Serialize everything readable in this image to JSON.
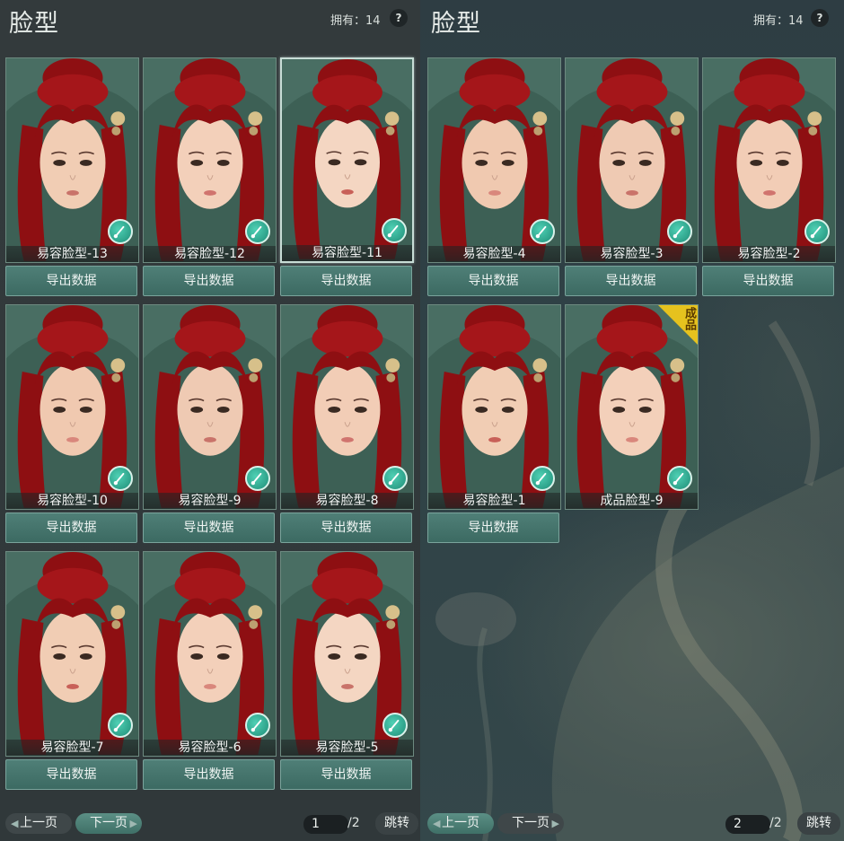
{
  "left_panel": {
    "title": "脸型",
    "owned_label": "拥有：14",
    "help_label": "?",
    "cards": [
      {
        "label": "易容脸型-13",
        "export": "导出数据",
        "selected": false,
        "tag": ""
      },
      {
        "label": "易容脸型-12",
        "export": "导出数据",
        "selected": false,
        "tag": ""
      },
      {
        "label": "易容脸型-11",
        "export": "导出数据",
        "selected": true,
        "tag": ""
      },
      {
        "label": "易容脸型-10",
        "export": "导出数据",
        "selected": false,
        "tag": ""
      },
      {
        "label": "易容脸型-9",
        "export": "导出数据",
        "selected": false,
        "tag": ""
      },
      {
        "label": "易容脸型-8",
        "export": "导出数据",
        "selected": false,
        "tag": ""
      },
      {
        "label": "易容脸型-7",
        "export": "导出数据",
        "selected": false,
        "tag": ""
      },
      {
        "label": "易容脸型-6",
        "export": "导出数据",
        "selected": false,
        "tag": ""
      },
      {
        "label": "易容脸型-5",
        "export": "导出数据",
        "selected": false,
        "tag": ""
      }
    ],
    "pager": {
      "prev": "上一页",
      "next": "下一页",
      "page": "1",
      "total": "/2",
      "jump": "跳转"
    }
  },
  "right_panel": {
    "title": "脸型",
    "owned_label": "拥有：14",
    "help_label": "?",
    "cards": [
      {
        "label": "易容脸型-4",
        "export": "导出数据",
        "selected": false,
        "tag": ""
      },
      {
        "label": "易容脸型-3",
        "export": "导出数据",
        "selected": false,
        "tag": ""
      },
      {
        "label": "易容脸型-2",
        "export": "导出数据",
        "selected": false,
        "tag": ""
      },
      {
        "label": "易容脸型-1",
        "export": "导出数据",
        "selected": false,
        "tag": ""
      },
      {
        "label": "成品脸型-9",
        "export": "",
        "selected": false,
        "tag": "成品"
      }
    ],
    "pager": {
      "prev": "上一页",
      "next": "下一页",
      "page": "2",
      "total": "/2",
      "jump": "跳转"
    }
  },
  "colors": {
    "accent_teal": "#3c6a62",
    "hair_red": "#8e0f12",
    "badge_gold": "#e6c21e"
  },
  "icons": {
    "card_corner": "brush-icon",
    "help": "help-icon"
  }
}
